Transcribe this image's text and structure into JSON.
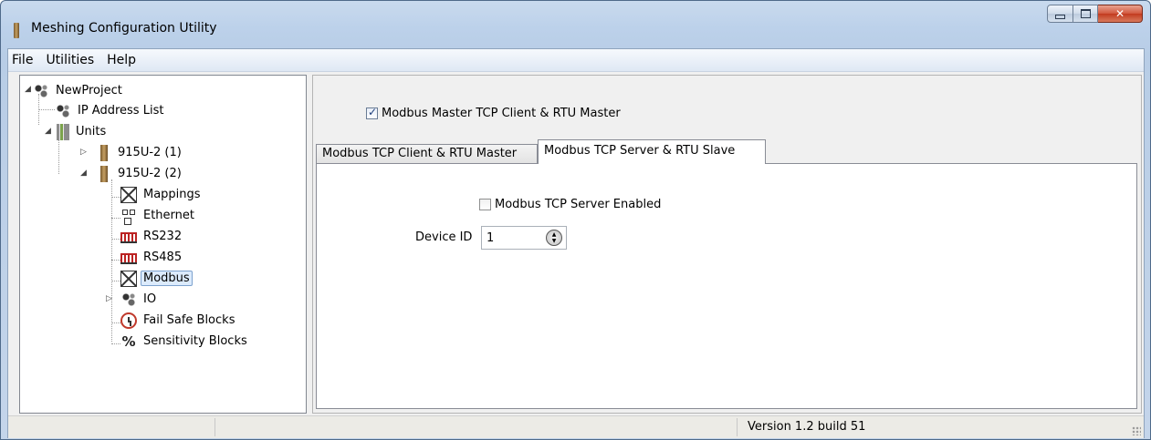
{
  "window": {
    "title": "Meshing Configuration Utility"
  },
  "menu": {
    "file": "File",
    "utilities": "Utilities",
    "help": "Help"
  },
  "tree": {
    "project": "NewProject",
    "ip_list": "IP Address List",
    "units": "Units",
    "unit1": "915U-2 (1)",
    "unit2": "915U-2 (2)",
    "mappings": "Mappings",
    "ethernet": "Ethernet",
    "rs232": "RS232",
    "rs485": "RS485",
    "modbus": "Modbus",
    "io": "IO",
    "failsafe": "Fail Safe Blocks",
    "sensitivity": "Sensitivity Blocks"
  },
  "panel": {
    "master_checkbox": "Modbus Master TCP Client & RTU Master",
    "master_checked": true,
    "tab1": "Modbus TCP Client & RTU Master",
    "tab2": "Modbus TCP Server & RTU Slave",
    "active_tab": "Modbus TCP Server & RTU Slave",
    "server_checkbox": "Modbus TCP Server Enabled",
    "server_checked": false,
    "device_id_label": "Device ID",
    "device_id_value": "1"
  },
  "status": {
    "version": "Version 1.2 build 51"
  }
}
